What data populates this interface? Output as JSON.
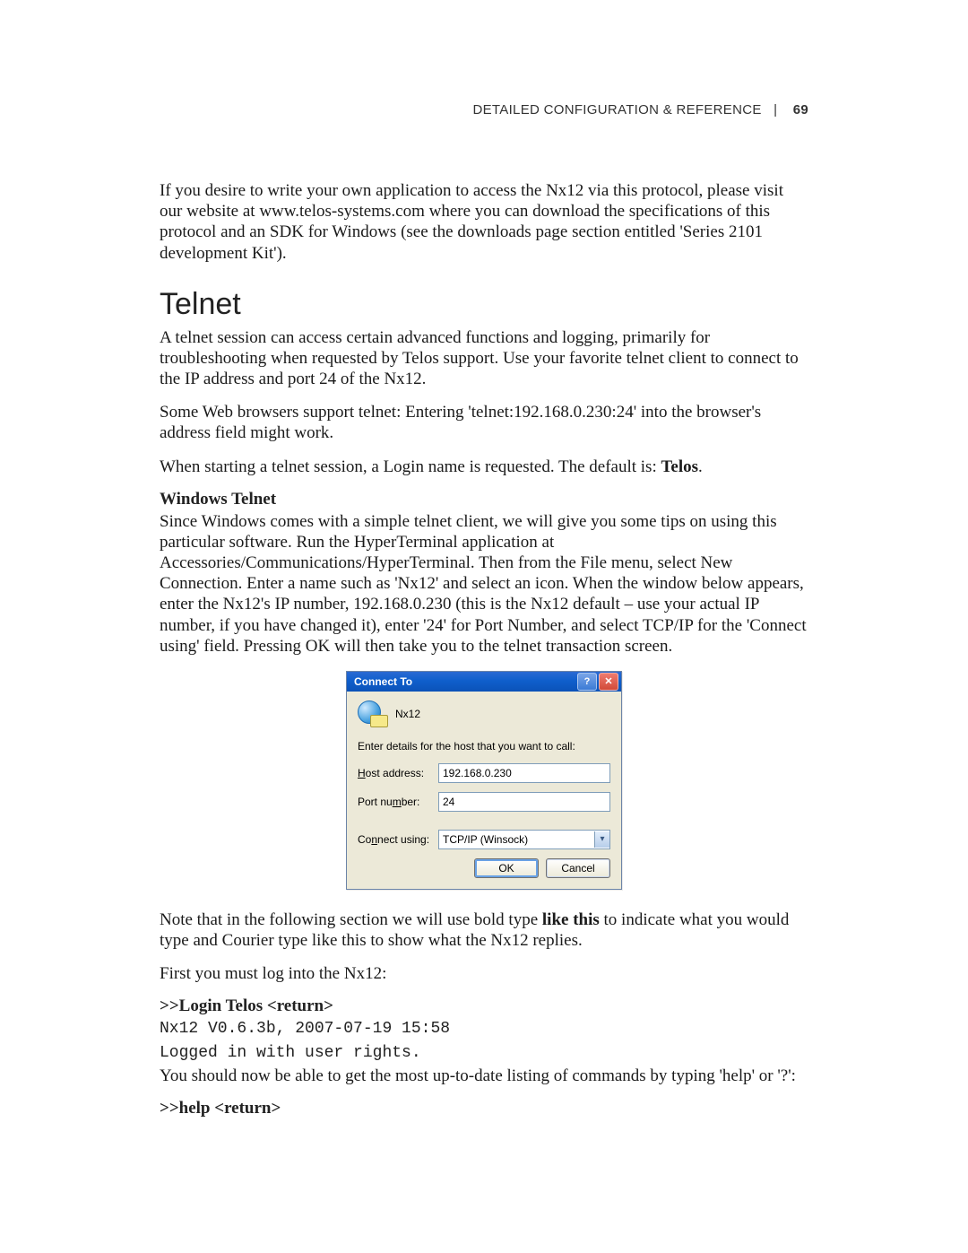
{
  "header": {
    "section": "DETAILED CONFIGURATION & REFERENCE",
    "separator": "|",
    "page_number": "69"
  },
  "intro_para": "If you desire to write your own application to access the Nx12 via this protocol, please visit our website at www.telos-systems.com where you can download the specifications of this protocol and an SDK for Windows (see the downloads page section entitled 'Series 2101 development Kit').",
  "telnet": {
    "title": "Telnet",
    "p1": "A telnet session can access certain advanced functions and logging, primarily for troubleshooting when requested by Telos support. Use your favorite telnet client to connect to the IP address and port 24 of the Nx12.",
    "p2": "Some Web browsers support telnet: Entering 'telnet:192.168.0.230:24' into the browser's address field might work.",
    "p3_pre": "When starting a telnet session, a Login name is requested. The default is: ",
    "p3_bold": "Telos",
    "p3_post": ".",
    "win_head": "Windows Telnet",
    "win_para": "Since Windows comes with a simple telnet client, we will give you some tips on using this particular software. Run the HyperTerminal application at Accessories/Communications/HyperTerminal. Then from the File menu, select New Connection. Enter a name such as 'Nx12' and select an icon. When the window below appears, enter the Nx12's IP number, 192.168.0.230 (this is the Nx12 default – use your actual IP number, if you have changed it), enter '24' for Port Number, and select TCP/IP for the 'Connect using' field. Pressing OK will then take you to the telnet transaction screen.",
    "note_pre": "Note that in the following section we will use bold type ",
    "note_bold": "like this",
    "note_post": " to indicate what you would type and Courier type like this to show what the Nx12 replies.",
    "first_login": "First you must log into the Nx12:",
    "cmd_login": ">>Login Telos <return>",
    "reply1": "Nx12  V0.6.3b, 2007-07-19 15:58",
    "reply2": "Logged in with user rights.",
    "help_line": "You should now be able to get the most up-to-date listing of commands by typing 'help' or '?':",
    "cmd_help": ">>help <return>"
  },
  "dialog": {
    "title": "Connect To",
    "conn_name": "Nx12",
    "instruction": "Enter details for the host that you want to call:",
    "host_label_pre": "H",
    "host_label_post": "ost address:",
    "host_value": "192.168.0.230",
    "port_label_pre": "Port nu",
    "port_label_ul": "m",
    "port_label_post": "ber:",
    "port_value": "24",
    "connect_label_pre": "Co",
    "connect_label_ul": "n",
    "connect_label_post": "nect using:",
    "connect_value": "TCP/IP (Winsock)",
    "ok": "OK",
    "cancel": "Cancel"
  }
}
